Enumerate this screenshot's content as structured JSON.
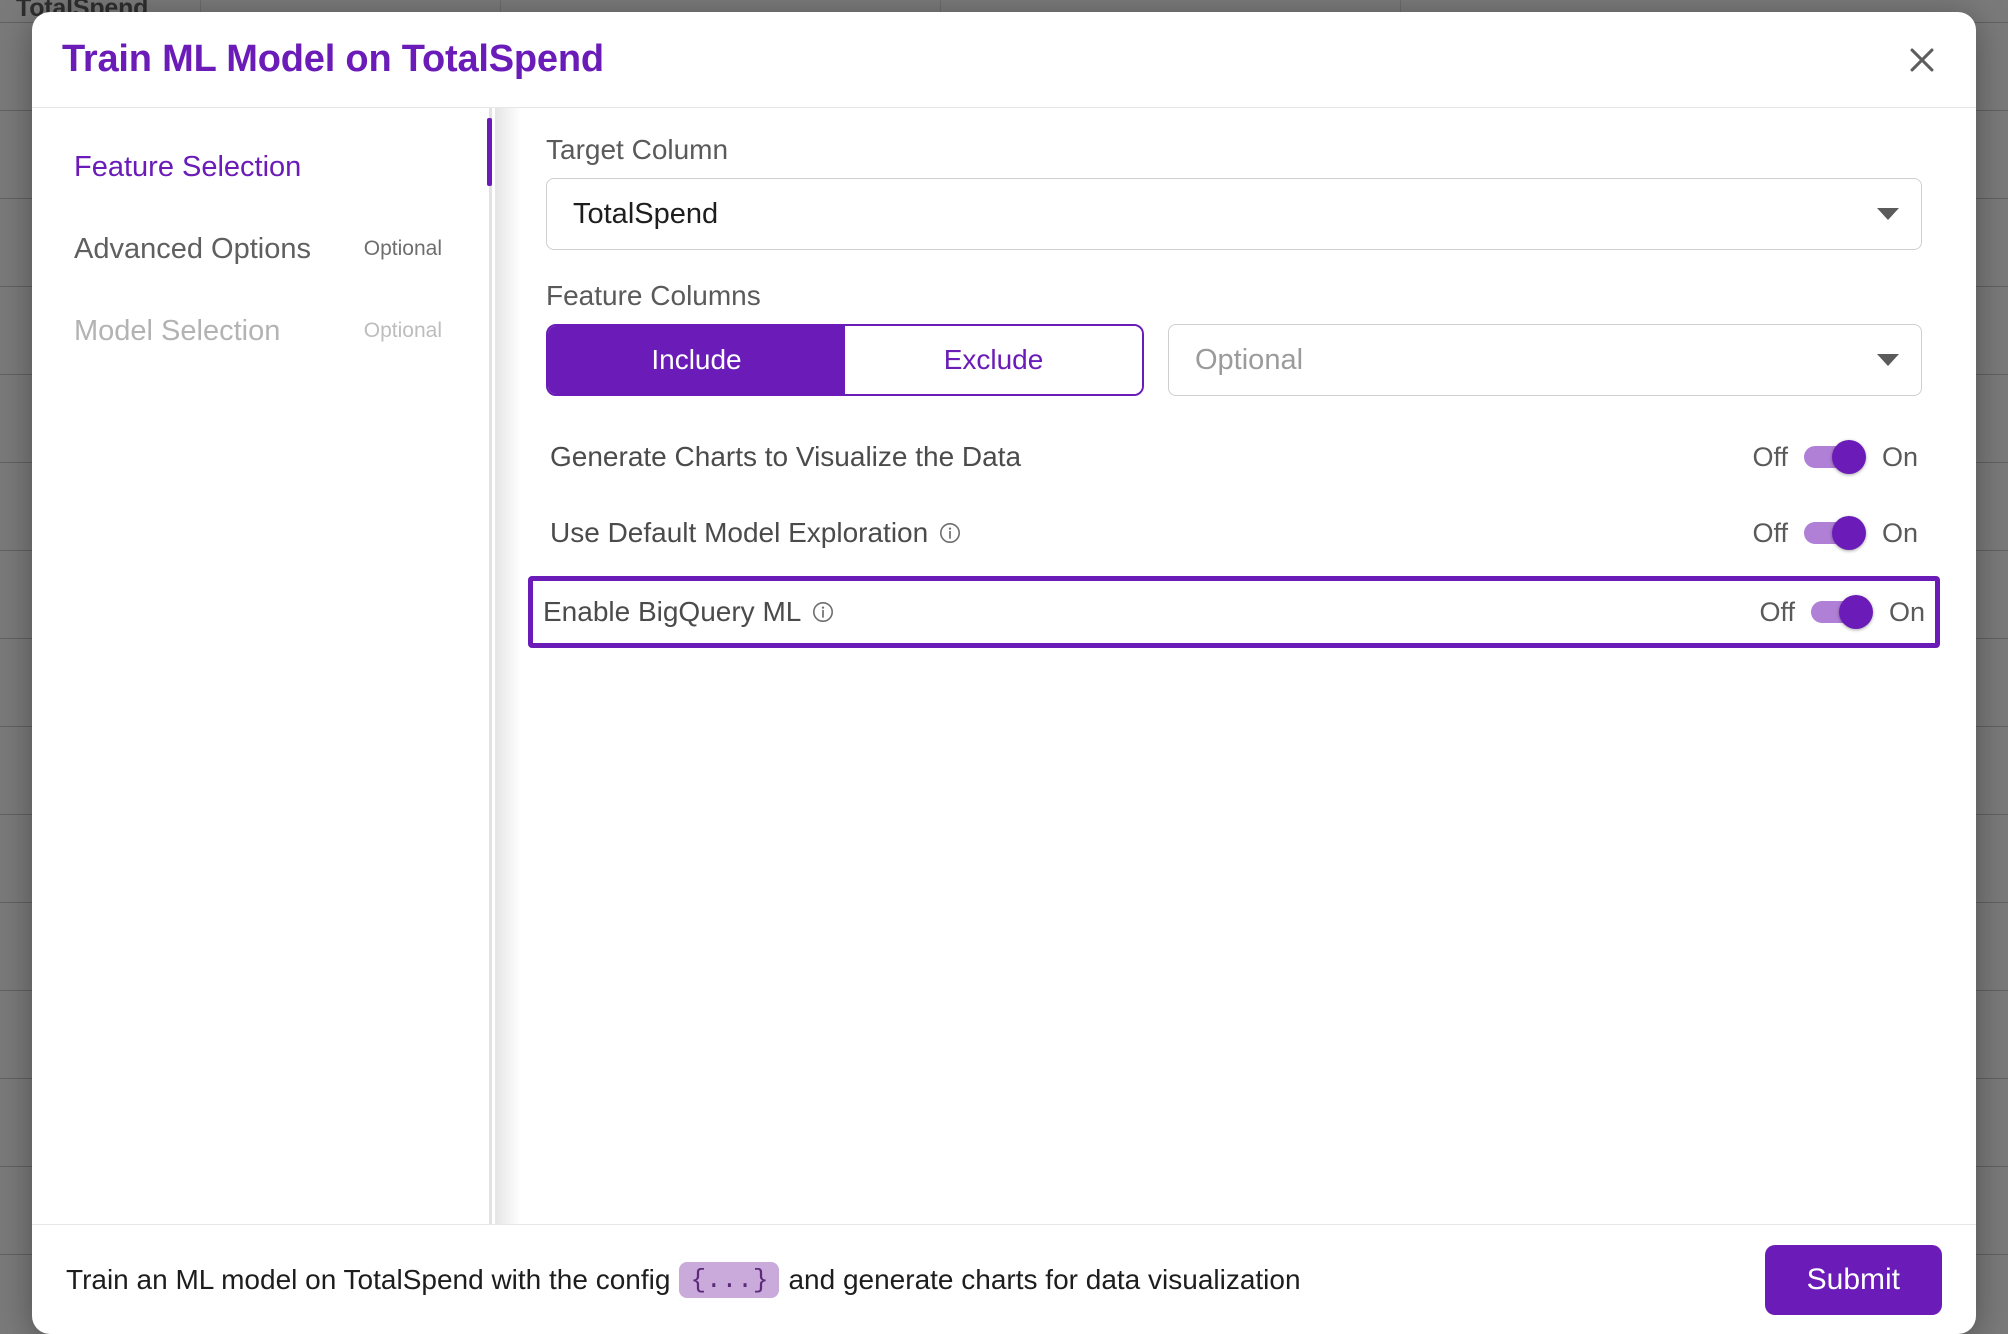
{
  "background": {
    "partial_header_text": "TotalSpend"
  },
  "modal": {
    "title": "Train ML Model on TotalSpend",
    "close_icon": "close-icon"
  },
  "sidebar": {
    "items": [
      {
        "label": "Feature Selection",
        "tag": "",
        "state": "active"
      },
      {
        "label": "Advanced Options",
        "tag": "Optional",
        "state": "enabled"
      },
      {
        "label": "Model Selection",
        "tag": "Optional",
        "state": "disabled"
      }
    ]
  },
  "main": {
    "target_column": {
      "label": "Target Column",
      "value": "TotalSpend",
      "caret_icon": "chevron-down-icon"
    },
    "feature_columns": {
      "label": "Feature Columns",
      "include_label": "Include",
      "exclude_label": "Exclude",
      "selected": "Include",
      "select_placeholder": "Optional",
      "select_value": "",
      "caret_icon": "chevron-down-icon"
    },
    "toggles": [
      {
        "label": "Generate Charts to Visualize the Data",
        "has_info": false,
        "off_label": "Off",
        "on_label": "On",
        "state": "On",
        "highlighted": false
      },
      {
        "label": "Use Default Model Exploration",
        "has_info": true,
        "info_icon": "info-icon",
        "off_label": "Off",
        "on_label": "On",
        "state": "On",
        "highlighted": false
      },
      {
        "label": "Enable BigQuery ML",
        "has_info": true,
        "info_icon": "info-icon",
        "off_label": "Off",
        "on_label": "On",
        "state": "On",
        "highlighted": true
      }
    ]
  },
  "footer": {
    "text_before": "Train an ML model on TotalSpend with the config",
    "config_chip": "{...}",
    "text_after": "and generate charts for data visualization",
    "submit_label": "Submit"
  },
  "colors": {
    "brand_purple": "#6B1CB8",
    "track_purple": "#b07fd6",
    "chip_bg": "#c9aada",
    "chip_text": "#5c2a7a"
  }
}
